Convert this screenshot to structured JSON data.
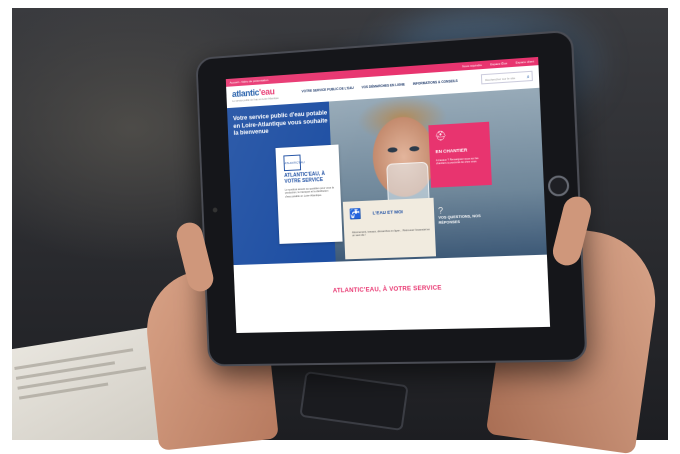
{
  "site": {
    "topbar": {
      "crumb": "Accueil › Vidéo de présentation",
      "links": [
        "Nous rejoindre",
        "Espace Élus",
        "Espace client"
      ]
    },
    "logo": {
      "main": "atlantic",
      "accent": "'eau",
      "sub": "Le service public de l'eau en Loire-Atlantique"
    },
    "nav": [
      "VOTRE SERVICE PUBLIC DE L'EAU",
      "VOS DÉMARCHES EN LIGNE",
      "INFORMATIONS & CONSEILS"
    ],
    "search_placeholder": "Rechercher sur le site",
    "hero_title": "Votre service public d'eau potable en Loire-Atlantique vous souhaite la bienvenue",
    "card_service": {
      "emblem": "ATLANTIC'EAU",
      "title": "ATLANTIC'EAU, À VOTRE SERVICE",
      "text": "Le syndicat assure au quotidien pour vous la production, le transport et la distribution d'eau potable en Loire-Atlantique."
    },
    "card_chantier": {
      "title": "EN CHANTIER",
      "text": "A travaux ? Renseignez-vous sur les chantiers à proximité de chez vous."
    },
    "card_eau": {
      "title": "L'EAU ET MOI",
      "text": "Abonnement, travaux, démarches en ligne... Retrouvez l'essentiel en un seul clic !"
    },
    "faq_title": "VOS QUESTIONS, NOS RÉPONSES",
    "footer_title": "ATLANTIC'EAU, À VOTRE SERVICE"
  },
  "colors": {
    "pink": "#e8346f",
    "blue": "#1e4fa3",
    "beige": "#f1ebdf"
  }
}
